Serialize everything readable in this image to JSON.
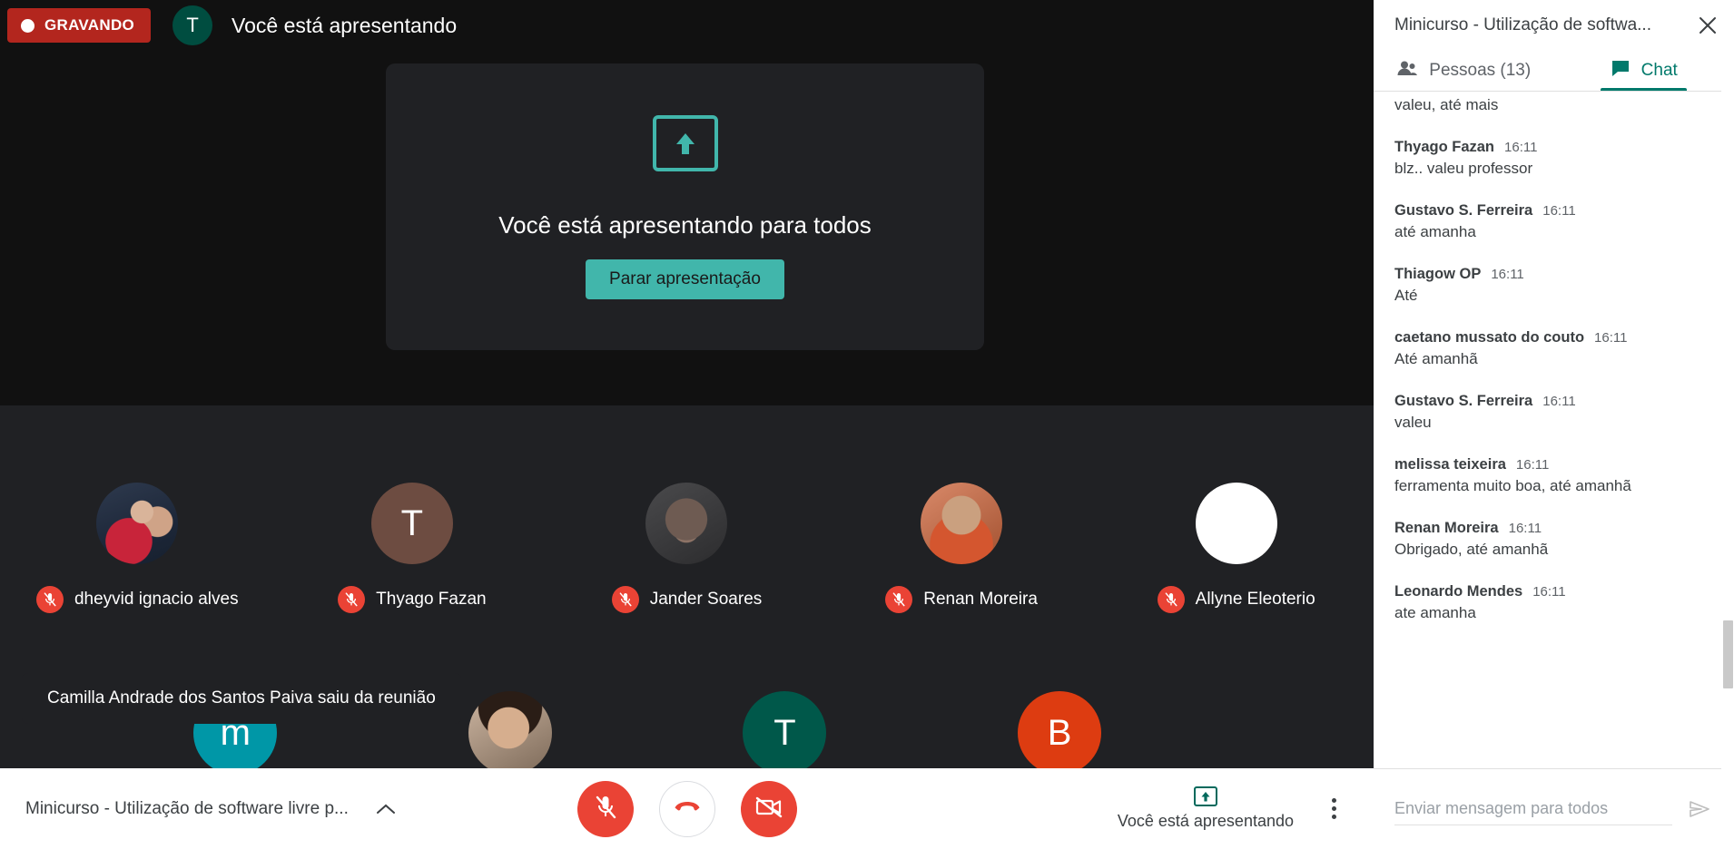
{
  "topbar": {
    "recording_label": "GRAVANDO",
    "avatar_initial": "T",
    "status_title": "Você está apresentando"
  },
  "present_card": {
    "icon": "present-screen-icon",
    "headline": "Você está apresentando para todos",
    "stop_label": "Parar apresentação"
  },
  "tiles": {
    "row1": [
      {
        "name": "dheyvid ignacio alves",
        "avatar_type": "photo",
        "photo_class": "photo-a",
        "muted": true
      },
      {
        "name": "Thyago Fazan",
        "avatar_type": "initial",
        "initial": "T",
        "color": "#6d4c41",
        "muted": true
      },
      {
        "name": "Jander Soares",
        "avatar_type": "photo",
        "photo_class": "photo-b",
        "muted": true
      },
      {
        "name": "Renan Moreira",
        "avatar_type": "photo",
        "photo_class": "photo-c",
        "muted": true
      },
      {
        "name": "Allyne Eleoterio",
        "avatar_type": "initial",
        "initial": "",
        "color": "#ffffff",
        "muted": true
      }
    ],
    "row2": [
      {
        "name": "",
        "avatar_type": "initial",
        "initial": "m",
        "color": "#0097a7",
        "muted": false
      },
      {
        "name": "",
        "avatar_type": "photo",
        "photo_class": "photo-d",
        "muted": false
      },
      {
        "name": "",
        "avatar_type": "initial",
        "initial": "T",
        "color": "#00584a",
        "muted": false
      },
      {
        "name": "",
        "avatar_type": "initial",
        "initial": "B",
        "color": "#dd3c11",
        "muted": false
      }
    ]
  },
  "toast": {
    "message": "Camilla Andrade dos Santos Paiva saiu da reunião"
  },
  "bottombar": {
    "meeting_name": "Minicurso - Utilização de software livre p...",
    "expand_icon": "chevron-up-icon",
    "mic_button": "mic-off-icon",
    "hangup_button": "hangup-icon",
    "camera_button": "camera-off-icon",
    "present_status_label": "Você está apresentando",
    "more_options": "more-vertical-icon"
  },
  "panel": {
    "title": "Minicurso - Utilização de softwa...",
    "close_icon": "close-icon",
    "tabs": [
      {
        "id": "people",
        "label": "Pessoas (13)",
        "icon": "people-icon",
        "active": false
      },
      {
        "id": "chat",
        "label": "Chat",
        "icon": "chat-icon",
        "active": true
      }
    ],
    "accent_color": "#00796b",
    "messages": [
      {
        "author": "",
        "time": "",
        "body": "valeu, até mais",
        "partial": true
      },
      {
        "author": "Thyago Fazan",
        "time": "16:11",
        "body": "blz.. valeu professor",
        "partial": false
      },
      {
        "author": "Gustavo S. Ferreira",
        "time": "16:11",
        "body": "até amanha",
        "partial": false
      },
      {
        "author": "Thiagow OP",
        "time": "16:11",
        "body": "Até",
        "partial": false
      },
      {
        "author": "caetano mussato do couto",
        "time": "16:11",
        "body": "Até amanhã",
        "partial": false
      },
      {
        "author": "Gustavo S. Ferreira",
        "time": "16:11",
        "body": "valeu",
        "partial": false
      },
      {
        "author": "melissa teixeira",
        "time": "16:11",
        "body": "ferramenta muito boa, até amanhã",
        "partial": false
      },
      {
        "author": "Renan Moreira",
        "time": "16:11",
        "body": "Obrigado, até amanhã",
        "partial": false
      },
      {
        "author": "Leonardo Mendes",
        "time": "16:11",
        "body": "ate amanha",
        "partial": false
      }
    ],
    "composer": {
      "placeholder": "Enviar mensagem para todos",
      "value": "",
      "send_icon": "send-icon"
    }
  }
}
